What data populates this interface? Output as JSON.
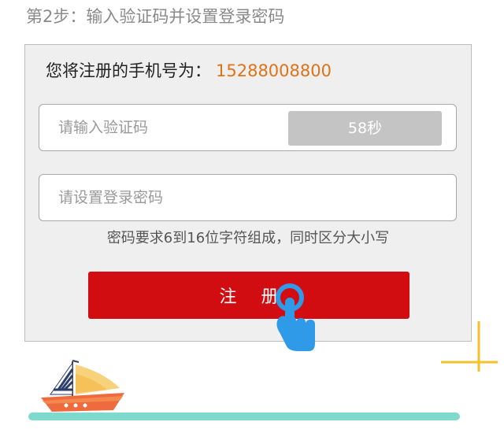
{
  "step": {
    "title": "第2步：输入验证码并设置登录密码"
  },
  "card": {
    "phone_label": "您将注册的手机号为：",
    "phone_number": "15288008800",
    "code_placeholder": "请输入验证码",
    "countdown_label": "58秒",
    "password_placeholder": "请设置登录密码",
    "hint": "密码要求6到16位字符组成，同时区分大小写",
    "register_label": "注 册"
  },
  "colors": {
    "accent": "#d10d12",
    "phone_number": "#e07218",
    "countdown_bg": "#c4c4c4",
    "pointer": "#2f9be8"
  },
  "icons": [
    "tap-hand-icon",
    "sailboat-illustration",
    "corner-crosshair-icon"
  ]
}
